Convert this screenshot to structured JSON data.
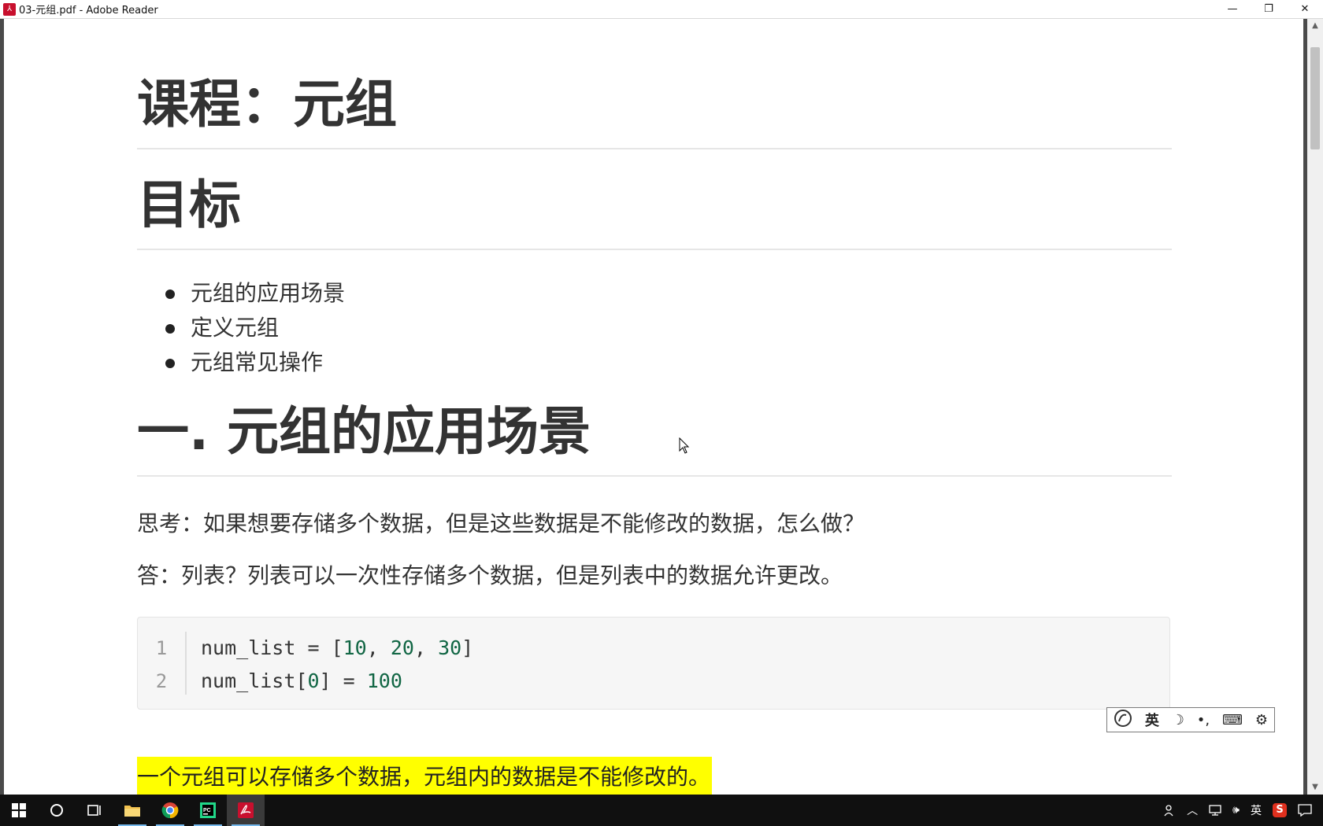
{
  "window": {
    "title": "03-元组.pdf - Adobe Reader",
    "app_icon": "pdf-icon",
    "minimize": "—",
    "restore": "❐",
    "close": "✕"
  },
  "document": {
    "course_heading": "课程：元组",
    "goal_heading": "目标",
    "goals": [
      "元组的应用场景",
      "定义元组",
      "元组常见操作"
    ],
    "section_heading": "一. 元组的应用场景",
    "question": "思考：如果想要存储多个数据，但是这些数据是不能修改的数据，怎么做？",
    "answer": "答：列表？列表可以一次性存储多个数据，但是列表中的数据允许更改。",
    "code": {
      "line_numbers": [
        "1",
        "2"
      ],
      "line1": {
        "a": "num_list = [",
        "n1": "10",
        "s1": ", ",
        "n2": "20",
        "s2": ", ",
        "n3": "30",
        "b": "]"
      },
      "line2": {
        "a": "num_list[",
        "n1": "0",
        "b": "] = ",
        "n2": "100"
      }
    },
    "highlight": "一个元组可以存储多个数据，元组内的数据是不能修改的。"
  },
  "ime_toolbar": {
    "mode_label": "英",
    "icons": [
      "sogou-logo-icon",
      "moon-icon",
      "punctuation-icon",
      "keyboard-icon",
      "gear-icon"
    ]
  },
  "taskbar": {
    "items": [
      "windows-start-icon",
      "search-circle-icon",
      "task-view-icon",
      "file-explorer-icon",
      "chrome-icon",
      "pycharm-icon",
      "adobe-reader-icon"
    ],
    "tray_lang": "英",
    "tray_ime": "S"
  },
  "colors": {
    "highlight": "#ffff00",
    "code_number": "#116644",
    "taskbar": "#101010"
  }
}
